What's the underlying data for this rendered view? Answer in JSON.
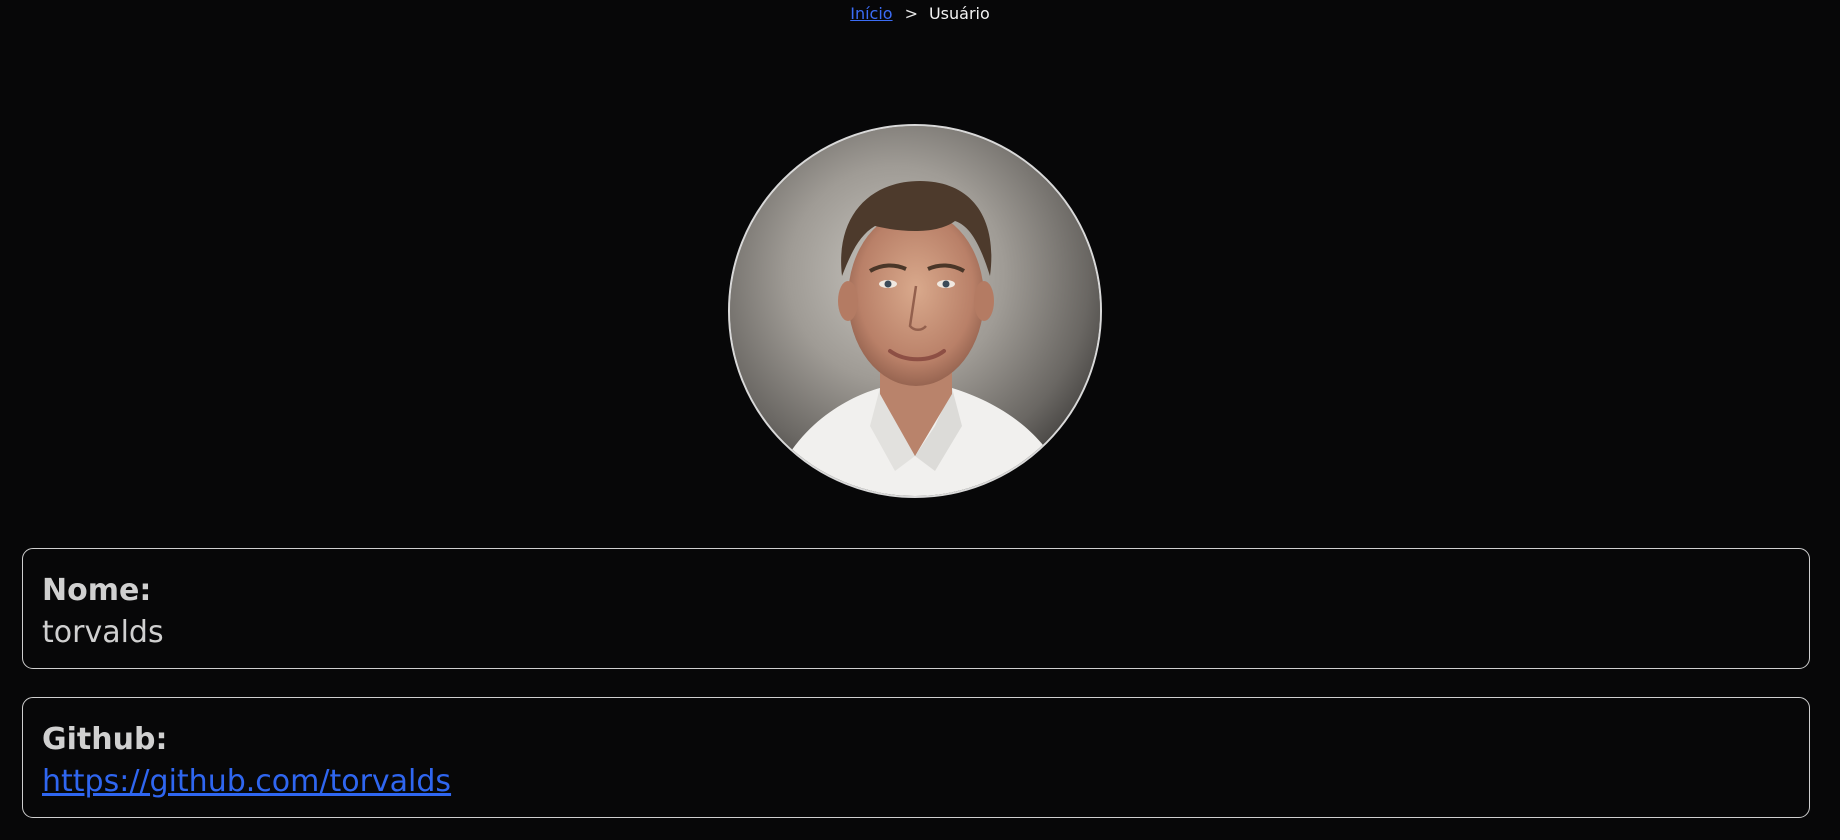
{
  "breadcrumb": {
    "home_label": "Início",
    "separator": ">",
    "current_label": "Usuário"
  },
  "profile": {
    "avatar_icon": "user-avatar-photo",
    "name_label": "Nome:",
    "name_value": "torvalds",
    "github_label": "Github:",
    "github_value": "https://github.com/torvalds"
  },
  "colors": {
    "background": "#070708",
    "link": "#2f66f0",
    "text": "#d0d0d0",
    "border": "#cfcfcf"
  }
}
